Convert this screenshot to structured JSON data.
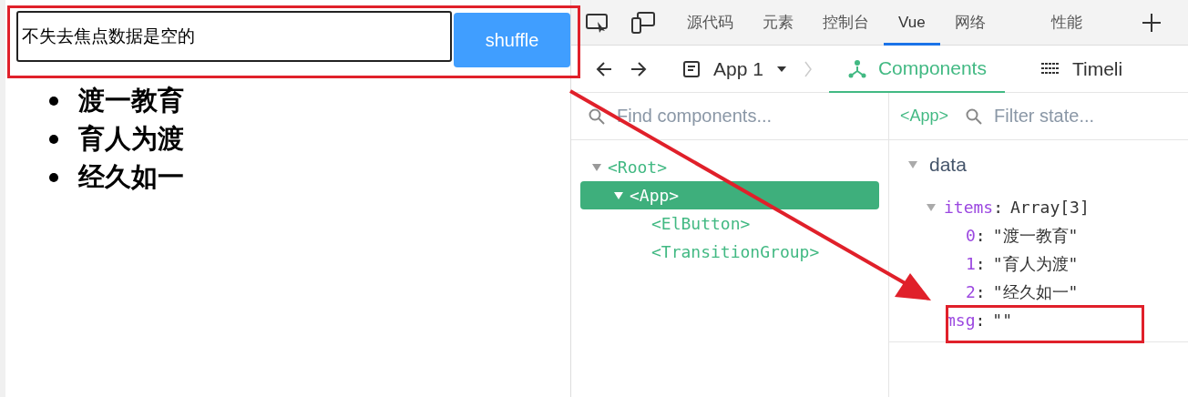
{
  "app": {
    "input": {
      "value": "不失去焦点数据是空的"
    },
    "button": "shuffle",
    "list": [
      "渡一教育",
      "育人为渡",
      "经久如一"
    ]
  },
  "devtools": {
    "tabs": [
      {
        "label": "源代码",
        "selected": false
      },
      {
        "label": "元素",
        "selected": false
      },
      {
        "label": "控制台",
        "selected": false
      },
      {
        "label": "Vue",
        "selected": true
      },
      {
        "label": "网络",
        "selected": false
      },
      {
        "label": "性能",
        "selected": false
      }
    ],
    "app_select": "App 1",
    "views": [
      {
        "label": "Components",
        "selected": true
      },
      {
        "label": "Timeli",
        "selected": false
      }
    ]
  },
  "tree": {
    "placeholder": "Find components...",
    "nodes": [
      {
        "label": "<Root>",
        "expanded": true,
        "selected": false,
        "children": [
          {
            "label": "<App>",
            "expanded": true,
            "selected": true,
            "children": [
              {
                "label": "<ElButton>",
                "selected": false
              },
              {
                "label": "<TransitionGroup>",
                "selected": false
              }
            ]
          }
        ]
      }
    ]
  },
  "inspector": {
    "component": "<App>",
    "placeholder": "Filter state...",
    "section": {
      "title": "data",
      "expanded": true
    },
    "fields": [
      {
        "key": "items",
        "sep": ":",
        "value": "Array[3]",
        "expanded": true,
        "children": [
          {
            "key": "0",
            "sep": ":",
            "value": "\"渡一教育\""
          },
          {
            "key": "1",
            "sep": ":",
            "value": "\"育人为渡\""
          },
          {
            "key": "2",
            "sep": ":",
            "value": "\"经久如一\""
          }
        ]
      },
      {
        "key": "msg",
        "sep": ":",
        "value": "\"\""
      }
    ]
  }
}
